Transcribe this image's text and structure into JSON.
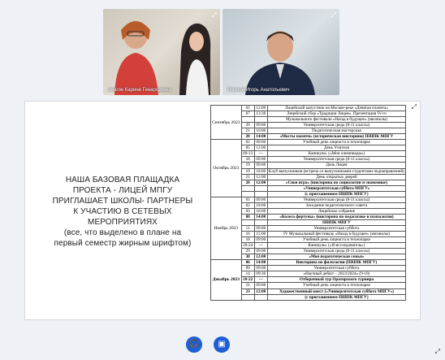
{
  "participants": [
    {
      "name": "Авагян Карине Генарозовна"
    },
    {
      "name": "Якимов Игорь Анатольевич"
    }
  ],
  "slide": {
    "left_text": "НАША БАЗОВАЯ ПЛАЩАДКА ПРОЕКТА - ЛИЦЕЙ МПГУ ПРИГЛАШАЕТ ШКОЛЫ- ПАРТНЕРЫ К УЧАСТИЮ В СЕТЕВЫХ МЕРОПРИЯТИЯХ",
    "left_note": "(все, что выделено в плане на первый семестр жирным шрифтом)",
    "months": {
      "sep": "Сентябрь 2023",
      "oct": "Октябрь 2023",
      "nov": "Ноябрь 2023",
      "dec": "Декабрь 2023"
    },
    "rows": [
      {
        "m": "sep",
        "day": "01",
        "time": "12:00",
        "ev": "Лицейский капустник на Москве-реке «Девятая планета»",
        "b": false
      },
      {
        "m": "",
        "day": "07",
        "time": "13:30",
        "ev": "Лицейский сбор «Традиции Лицея». Презентация IV-го",
        "b": false
      },
      {
        "m": "",
        "day": "",
        "time": "",
        "ev": "Музыкального фестиваля «Назад в будущее» (мюзиклы)",
        "b": false
      },
      {
        "m": "",
        "day": "20",
        "time": "09:00",
        "ev": "Университетская среда (8-11 классы)",
        "b": false
      },
      {
        "m": "",
        "day": "21",
        "time": "16:00",
        "ev": "Педагогическая мастерская",
        "b": false
      },
      {
        "m": "",
        "day": "28",
        "time": "14:00",
        "ev": "«Мосты памяти» (историческая викторина) ПШПК МПГУ",
        "b": true
      },
      {
        "m": "oct",
        "day": "02",
        "time": "09:00",
        "ev": "Учебный день лицеиста в технопарке",
        "b": false
      },
      {
        "m": "",
        "day": "05",
        "time": "12:00",
        "ev": "День Учителя",
        "b": false
      },
      {
        "m": "",
        "day": "09-13",
        "time": "---",
        "ev": "Каникулы. («Мои олимпиады»)",
        "b": false
      },
      {
        "m": "",
        "day": "18",
        "time": "09:00",
        "ev": "Университетская среда (8-11 классы)",
        "b": false
      },
      {
        "m": "",
        "day": "19",
        "time": "09:00",
        "ev": "День Лицея",
        "b": false
      },
      {
        "m": "",
        "day": "19",
        "time": "18:00",
        "ev": "Клуб выпускников (встреча со выпускниками-студентами педнаправлений)",
        "b": false
      },
      {
        "m": "",
        "day": "21",
        "time": "12:00",
        "ev": "День открытых дверей",
        "b": false
      },
      {
        "m": "",
        "day": "28",
        "time": "12:00",
        "ev": "«Своя игра» (викторина по социологии и экономике)",
        "b": true
      },
      {
        "m": "",
        "day": "",
        "time": "",
        "ev": "«Университетская суббота МПГУ»",
        "b": true
      },
      {
        "m": "",
        "day": "",
        "time": "",
        "ev": "(с приглашением ПШПК МПГУ)",
        "b": true
      },
      {
        "m": "nov",
        "day": "01",
        "time": "09:00",
        "ev": "Университетская среда (8-11 классы)",
        "b": false
      },
      {
        "m": "",
        "day": "02",
        "time": "18:00",
        "ev": "Заседание педагогического совета",
        "b": false
      },
      {
        "m": "",
        "day": "03",
        "time": "18:00",
        "ev": "Лицейское собрание",
        "b": false
      },
      {
        "m": "",
        "day": "08",
        "time": "14:00",
        "ev": "«Колесо фортуны» (викторина по педагогике и психологии)",
        "b": true
      },
      {
        "m": "",
        "day": "",
        "time": "",
        "ev": "ПШПК МПГУ",
        "b": true
      },
      {
        "m": "",
        "day": "11",
        "time": "09:00",
        "ev": "Университетская суббота",
        "b": false
      },
      {
        "m": "",
        "day": "16",
        "time": "15:00",
        "ev": "IV Музыкальный фестиваль «Назад в будущее» (мюзиклы)",
        "b": false
      },
      {
        "m": "",
        "day": "18",
        "time": "09:00",
        "ev": "Учебный день лицеиста в технопарке",
        "b": false
      },
      {
        "m": "",
        "day": "20-24",
        "time": "---",
        "ev": "Каникулы. («Я-исследователь»)",
        "b": false
      },
      {
        "m": "",
        "day": "29",
        "time": "09:00",
        "ev": "Университетская среда (8-11 классы)",
        "b": false
      },
      {
        "m": "",
        "day": "30",
        "time": "12:00",
        "ev": "«Моя педагогическая семья»",
        "b": true
      },
      {
        "m": "dec",
        "day": "06",
        "time": "14:00",
        "ev": "Викторина по филологии (ПШПК МПГУ)",
        "b": true
      },
      {
        "m": "",
        "day": "09",
        "time": "09:00",
        "ev": "Университетская суббота",
        "b": false
      },
      {
        "m": "",
        "day": "14",
        "time": "09:30",
        "ev": "«Научный дебют – 2023/2024» (9-10)",
        "b": false
      },
      {
        "m": "",
        "day": "18-22",
        "time": "---",
        "ev": "Отборочный тур Ораторского турнира",
        "b": true
      },
      {
        "m": "",
        "day": "21",
        "time": "09:00",
        "ev": "Учебный день лицеиста в технопарке",
        "b": false
      },
      {
        "m": "",
        "day": "23",
        "time": "12:00",
        "ev": "Художественный квест («Университетская суббота МПГУ»)",
        "b": true
      },
      {
        "m": "",
        "day": "",
        "time": "",
        "ev": "(с приглашением ПШПК МПГУ)",
        "b": true
      }
    ]
  },
  "controls": {
    "mic_icon": "headphones-icon",
    "cam_icon": "camera-off-icon"
  },
  "colors": {
    "accent": "#1f5fd6"
  }
}
